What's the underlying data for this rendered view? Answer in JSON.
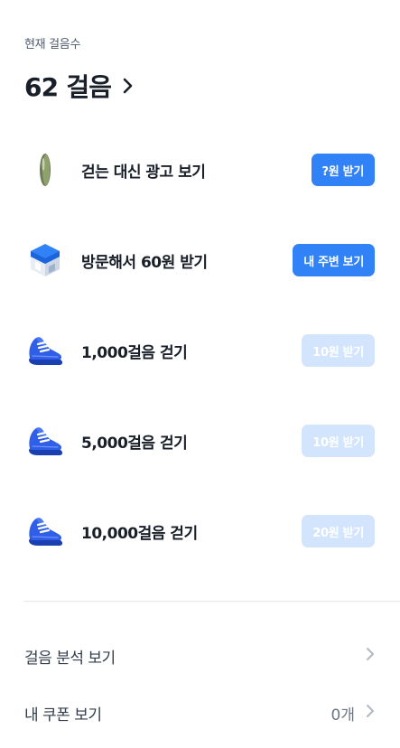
{
  "header": {
    "label": "현재 걸음수",
    "steps": "62 걸음",
    "chevron_icon": "chevron-right-icon"
  },
  "missions": [
    {
      "icon": "pill-coin-icon",
      "title": "걷는 대신 광고 보기",
      "button": "?원 받기",
      "state": "active"
    },
    {
      "icon": "store-icon",
      "title": "방문해서 60원 받기",
      "button": "내 주변 보기",
      "state": "active"
    },
    {
      "icon": "sneaker-icon",
      "title": "1,000걸음 걷기",
      "button": "10원 받기",
      "state": "disabled"
    },
    {
      "icon": "sneaker-icon",
      "title": "5,000걸음 걷기",
      "button": "10원 받기",
      "state": "disabled"
    },
    {
      "icon": "sneaker-icon",
      "title": "10,000걸음 걷기",
      "button": "20원 받기",
      "state": "disabled"
    }
  ],
  "menu": {
    "analysis": {
      "label": "걸음 분석 보기",
      "icon": "chevron-right-icon"
    },
    "coupons": {
      "label": "내 쿠폰 보기",
      "value": "0개",
      "icon": "chevron-right-icon"
    }
  },
  "colors": {
    "primary": "#3182f6",
    "disabled": "#d3e5fd",
    "text": "#191f28"
  }
}
